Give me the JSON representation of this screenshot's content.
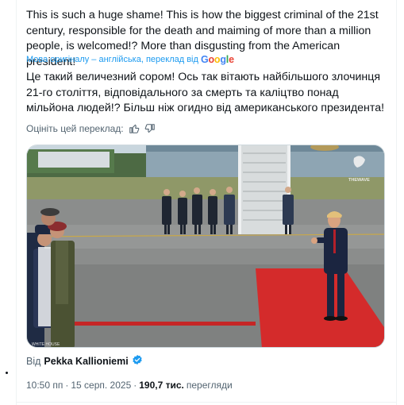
{
  "tweet": {
    "original_text": "This is such a huge shame! This is how the biggest criminal of the 21st century, responsible for the death and maiming of more than a million people, is welcomed!? More than disgusting from the American president!",
    "translation_note": "Мова оригіналу – англійська, переклад від",
    "translation_provider": "Google",
    "translated_text": "Це такий величезний сором! Ось так вітають найбільшого злочинця 21-го століття, відповідального за смерть та каліцтво понад мільйона людей!? Більш ніж огидно від американського президента!",
    "rate_label": "Оцініть цей переклад:",
    "media": {
      "watermark": "THEWAVE",
      "corner_text": "WHITE HOUSE"
    },
    "source_prefix": "Від",
    "source_author": "Pekka Kallioniemi",
    "time": "10:50 пп",
    "separator": "·",
    "date": "15 серп. 2025",
    "views_count": "190,7 тис.",
    "views_label": "перегляди"
  },
  "colors": {
    "link": "#1d9bf0",
    "verified": "#1d9bf0",
    "secondary_text": "#536471",
    "carpet": "#d42b2b"
  },
  "icons": [
    "thumbs-up-icon",
    "thumbs-down-icon",
    "verified-badge-icon"
  ]
}
